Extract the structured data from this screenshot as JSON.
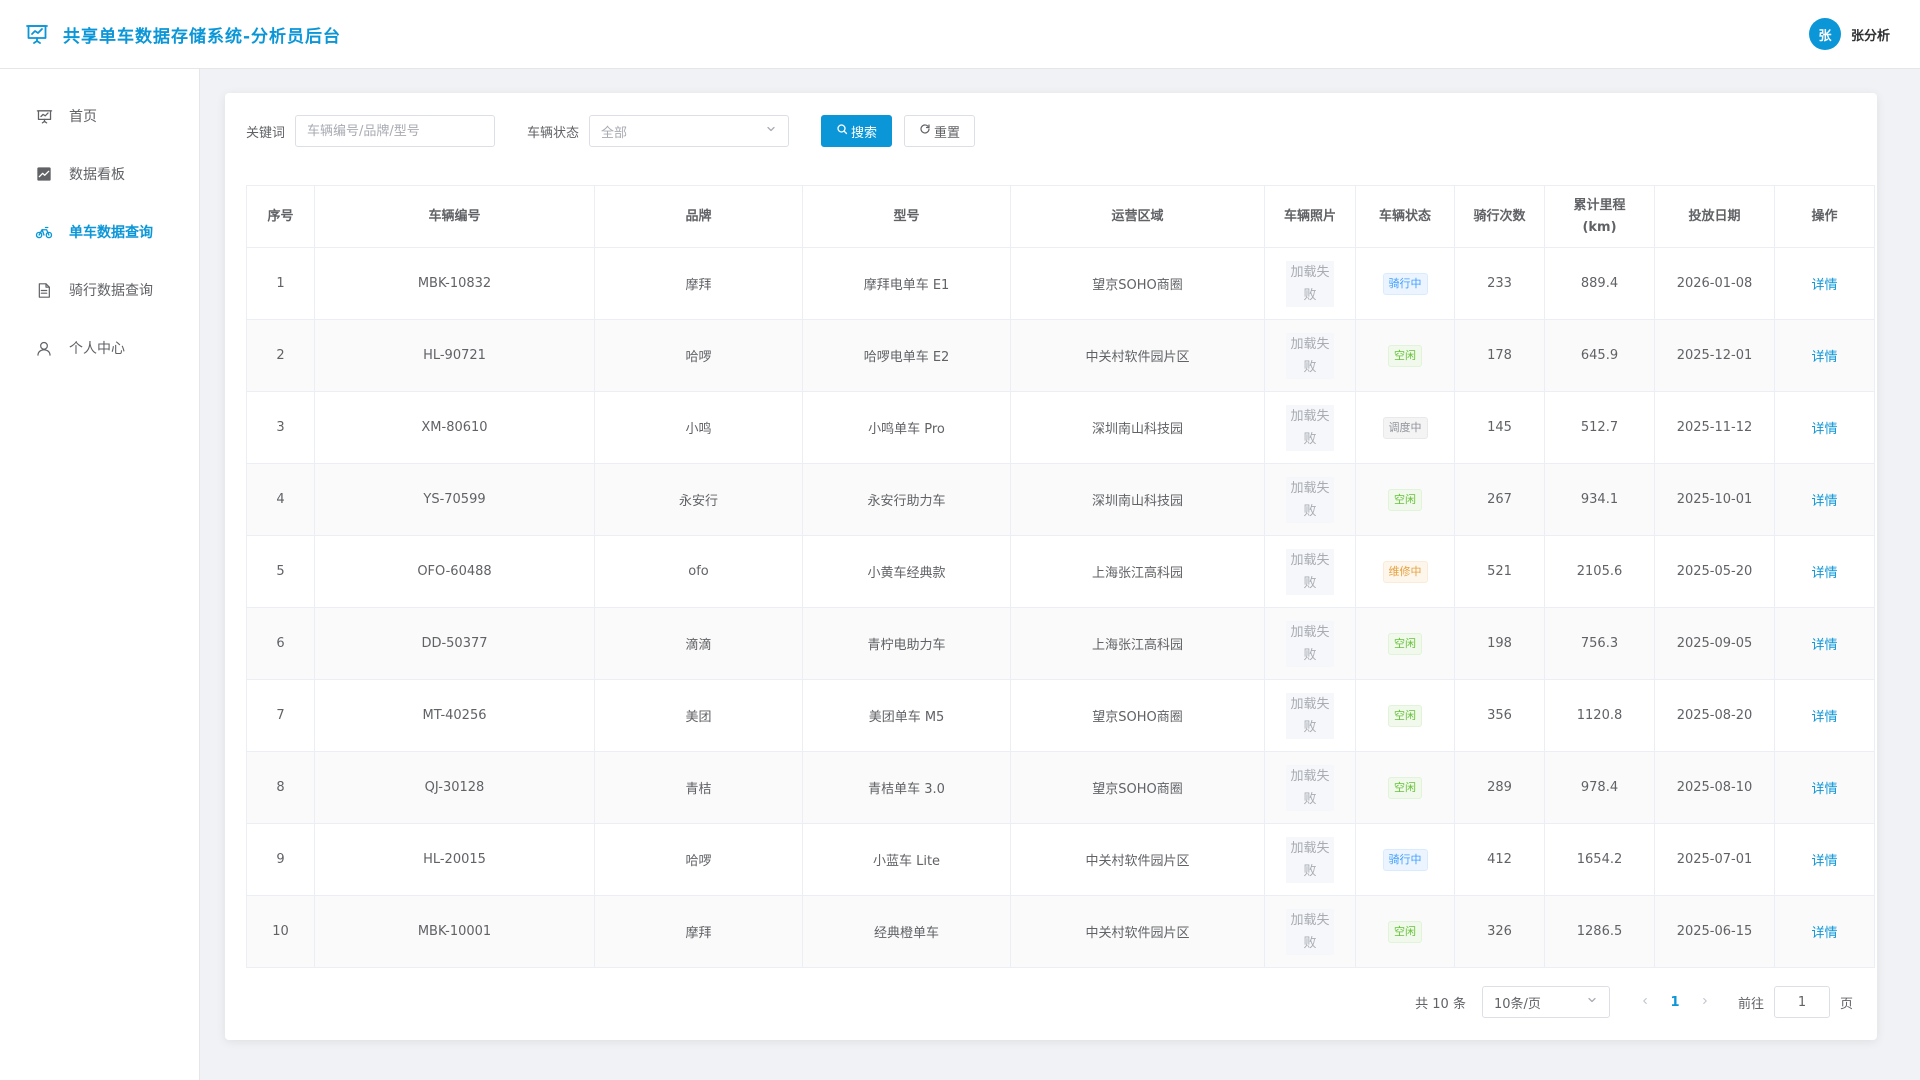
{
  "header": {
    "title": "共享单车数据存储系统-分析员后台",
    "avatar_char": "张",
    "user_name": "张分析"
  },
  "sidebar": {
    "items": [
      {
        "label": "首页",
        "icon": "presentation-icon"
      },
      {
        "label": "数据看板",
        "icon": "chart-icon"
      },
      {
        "label": "单车数据查询",
        "icon": "bicycle-icon",
        "active": true
      },
      {
        "label": "骑行数据查询",
        "icon": "document-icon"
      },
      {
        "label": "个人中心",
        "icon": "user-icon"
      }
    ]
  },
  "search": {
    "keyword_label": "关键词",
    "keyword_placeholder": "车辆编号/品牌/型号",
    "status_label": "车辆状态",
    "status_value": "全部",
    "search_label": "搜索",
    "reset_label": "重置"
  },
  "table": {
    "headers": [
      "序号",
      "车辆编号",
      "品牌",
      "型号",
      "运营区域",
      "车辆照片",
      "车辆状态",
      "骑行次数",
      "累计里程\n(km)",
      "投放日期",
      "操作"
    ],
    "rows": [
      {
        "no": "1",
        "code": "MBK-10832",
        "brand": "摩拜",
        "model": "摩拜电单车 E1",
        "area": "望京SOHO商圈",
        "photo": "加载失败",
        "status": "骑行中",
        "status_type": "riding",
        "rides": "233",
        "mileage": "889.4",
        "date": "2026-01-08",
        "action": "详情"
      },
      {
        "no": "2",
        "code": "HL-90721",
        "brand": "哈啰",
        "model": "哈啰电单车 E2",
        "area": "中关村软件园片区",
        "photo": "加载失败",
        "status": "空闲",
        "status_type": "idle",
        "rides": "178",
        "mileage": "645.9",
        "date": "2025-12-01",
        "action": "详情"
      },
      {
        "no": "3",
        "code": "XM-80610",
        "brand": "小鸣",
        "model": "小鸣单车 Pro",
        "area": "深圳南山科技园",
        "photo": "加载失败",
        "status": "调度中",
        "status_type": "dispatch",
        "rides": "145",
        "mileage": "512.7",
        "date": "2025-11-12",
        "action": "详情"
      },
      {
        "no": "4",
        "code": "YS-70599",
        "brand": "永安行",
        "model": "永安行助力车",
        "area": "深圳南山科技园",
        "photo": "加载失败",
        "status": "空闲",
        "status_type": "idle",
        "rides": "267",
        "mileage": "934.1",
        "date": "2025-10-01",
        "action": "详情"
      },
      {
        "no": "5",
        "code": "OFO-60488",
        "brand": "ofo",
        "model": "小黄车经典款",
        "area": "上海张江高科园",
        "photo": "加载失败",
        "status": "维修中",
        "status_type": "repair",
        "rides": "521",
        "mileage": "2105.6",
        "date": "2025-05-20",
        "action": "详情"
      },
      {
        "no": "6",
        "code": "DD-50377",
        "brand": "滴滴",
        "model": "青柠电助力车",
        "area": "上海张江高科园",
        "photo": "加载失败",
        "status": "空闲",
        "status_type": "idle",
        "rides": "198",
        "mileage": "756.3",
        "date": "2025-09-05",
        "action": "详情"
      },
      {
        "no": "7",
        "code": "MT-40256",
        "brand": "美团",
        "model": "美团单车 M5",
        "area": "望京SOHO商圈",
        "photo": "加载失败",
        "status": "空闲",
        "status_type": "idle",
        "rides": "356",
        "mileage": "1120.8",
        "date": "2025-08-20",
        "action": "详情"
      },
      {
        "no": "8",
        "code": "QJ-30128",
        "brand": "青桔",
        "model": "青桔单车 3.0",
        "area": "望京SOHO商圈",
        "photo": "加载失败",
        "status": "空闲",
        "status_type": "idle",
        "rides": "289",
        "mileage": "978.4",
        "date": "2025-08-10",
        "action": "详情"
      },
      {
        "no": "9",
        "code": "HL-20015",
        "brand": "哈啰",
        "model": "小蓝车 Lite",
        "area": "中关村软件园片区",
        "photo": "加载失败",
        "status": "骑行中",
        "status_type": "riding",
        "rides": "412",
        "mileage": "1654.2",
        "date": "2025-07-01",
        "action": "详情"
      },
      {
        "no": "10",
        "code": "MBK-10001",
        "brand": "摩拜",
        "model": "经典橙单车",
        "area": "中关村软件园片区",
        "photo": "加载失败",
        "status": "空闲",
        "status_type": "idle",
        "rides": "326",
        "mileage": "1286.5",
        "date": "2025-06-15",
        "action": "详情"
      }
    ]
  },
  "pagination": {
    "total_text": "共 10 条",
    "page_size": "10条/页",
    "current_page": "1",
    "goto_label": "前往",
    "goto_value": "1",
    "page_unit": "页"
  }
}
